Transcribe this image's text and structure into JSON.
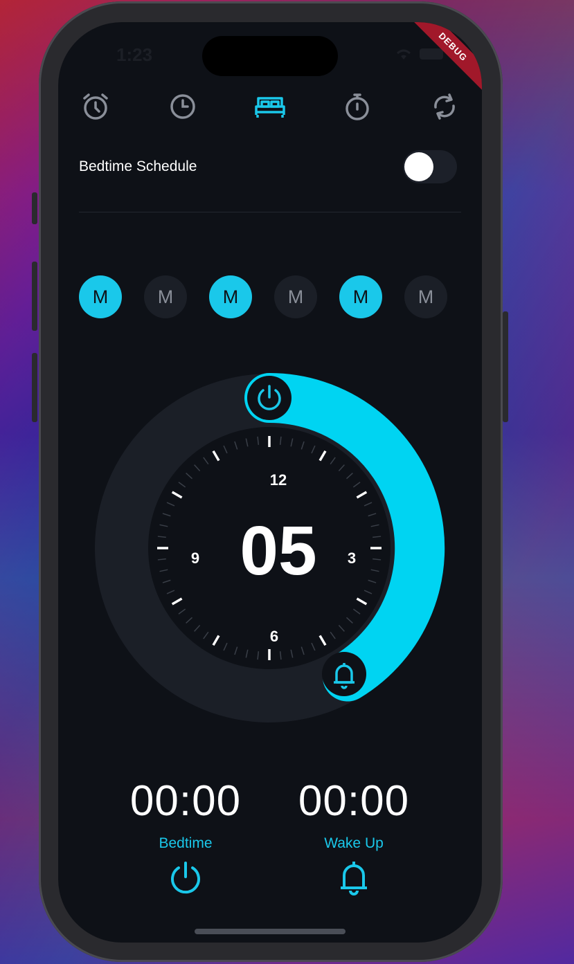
{
  "status": {
    "time": "1:23"
  },
  "debug_banner": "DEBUG",
  "tabs": [
    {
      "name": "alarm",
      "icon": "alarm-clock-icon",
      "active": false
    },
    {
      "name": "clock",
      "icon": "clock-icon",
      "active": false
    },
    {
      "name": "bedtime",
      "icon": "bed-icon",
      "active": true
    },
    {
      "name": "stopwatch",
      "icon": "stopwatch-icon",
      "active": false
    },
    {
      "name": "timer",
      "icon": "sync-icon",
      "active": false
    }
  ],
  "schedule": {
    "label": "Bedtime Schedule",
    "enabled": false
  },
  "days": [
    {
      "label": "M",
      "active": true
    },
    {
      "label": "M",
      "active": false
    },
    {
      "label": "M",
      "active": true
    },
    {
      "label": "M",
      "active": false
    },
    {
      "label": "M",
      "active": true
    },
    {
      "label": "M",
      "active": false
    }
  ],
  "dial": {
    "center_value": "05",
    "labels": {
      "top": "12",
      "right": "3",
      "bottom": "6",
      "left": "9"
    }
  },
  "bedtime": {
    "value": "00:00",
    "label": "Bedtime"
  },
  "wakeup": {
    "value": "00:00",
    "label": "Wake Up"
  },
  "colors": {
    "accent": "#1ac8ea",
    "background": "#0e1117",
    "track": "#1b1f27"
  }
}
